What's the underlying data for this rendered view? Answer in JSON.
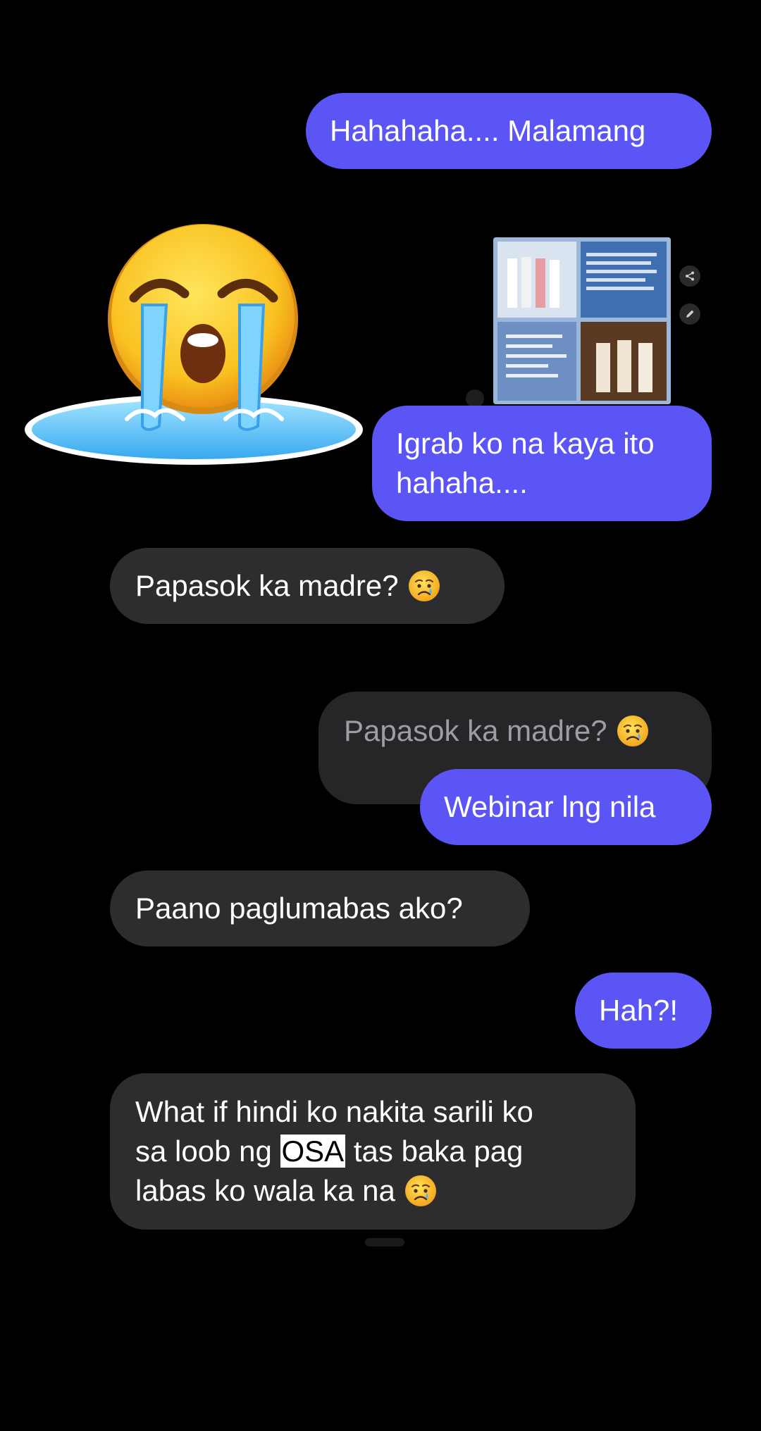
{
  "messages": [
    {
      "id": "m1",
      "type": "sent",
      "text": "Hahahaha.... Malamang"
    },
    {
      "id": "m2",
      "type": "sent",
      "line1": "Igrab ko na kaya ito",
      "line2": "hahaha...."
    },
    {
      "id": "m3",
      "type": "received",
      "text": "Papasok ka madre?"
    },
    {
      "id": "m4",
      "type": "reply_preview",
      "text": "Papasok ka madre?"
    },
    {
      "id": "m5",
      "type": "sent",
      "text": "Webinar lng nila"
    },
    {
      "id": "m6",
      "type": "received",
      "text": "Paano paglumabas ako?"
    },
    {
      "id": "m7",
      "type": "sent",
      "text": "Hah?!"
    },
    {
      "id": "m8",
      "type": "received",
      "line1": "What if hindi ko nakita sarili ko",
      "line2_before": "sa loob ng",
      "line2_highlight": "OSA",
      "line2_after": "tas baka pag",
      "line3": "labas ko wala ka na"
    }
  ],
  "icons": {
    "sticker": "crying-emoji-sticker",
    "emoji": "sad-but-relieved-face-icon",
    "share": "share-icon",
    "edit": "pencil-icon"
  },
  "colors": {
    "background": "#000000",
    "sent_bubble": "#5b55f6",
    "received_bubble": "#2d2d2f",
    "reply_preview_bubble": "#262628",
    "reply_preview_text": "#9d9da2"
  }
}
